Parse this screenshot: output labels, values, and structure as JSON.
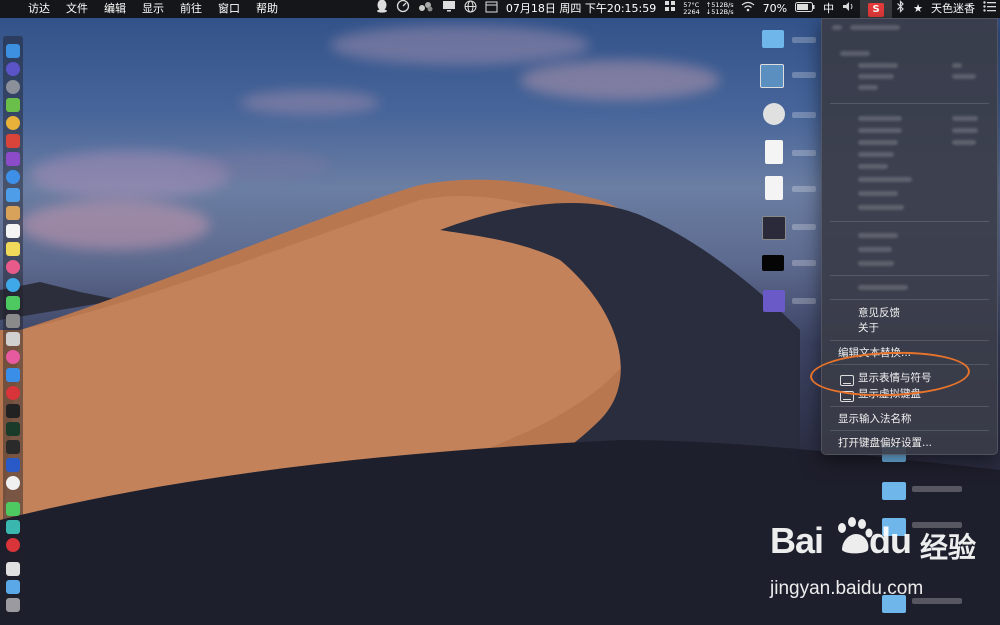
{
  "menubar": {
    "apple_glyph": "",
    "app_menus": [
      "访达",
      "文件",
      "编辑",
      "显示",
      "前往",
      "窗口",
      "帮助"
    ],
    "datetime": "07月18日 周四 下午20:15:59",
    "cpu_temp": "57°C",
    "fan_rpm": "2264",
    "net_up": "↑512B/s",
    "net_down": "↓512B/s",
    "battery": "70%",
    "input_method": "中",
    "sogou_label": "S",
    "user_name": "天色迷香"
  },
  "input_menu": {
    "items_top": [
      "意见反馈",
      "关于"
    ],
    "edit_replace": "编辑文本替换...",
    "show_emoji": "显示表情与符号",
    "show_virtual_keyboard": "显示虚拟键盘",
    "show_ime_name": "显示输入法名称",
    "open_keyboard_prefs": "打开键盘偏好设置..."
  },
  "watermark": {
    "brand_left": "Bai",
    "brand_right": "du",
    "brand_cn": "经验",
    "url": "jingyan.baidu.com"
  },
  "colors": {
    "highlight": "#e8732a",
    "menubar_bg": "#151619",
    "sogou_red": "#e73b3b"
  }
}
